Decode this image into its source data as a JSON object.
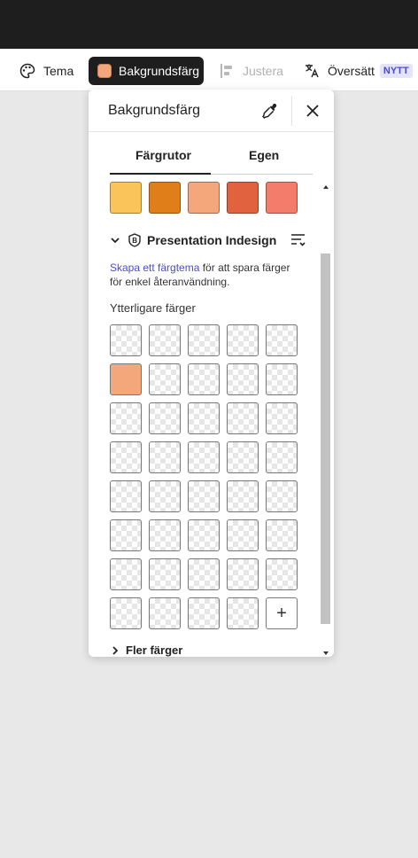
{
  "toolbar": {
    "tema_label": "Tema",
    "bakgrundsfarg_label": "Bakgrundsfärg",
    "justera_label": "Justera",
    "oversatt_label": "Översätt",
    "nytt_badge": "NYTT"
  },
  "panel": {
    "title": "Bakgrundsfärg",
    "tabs": [
      {
        "label": "Färgrutor",
        "active": true
      },
      {
        "label": "Egen",
        "active": false
      }
    ],
    "brand_colors": [
      "#fbc45b",
      "#e07f1a",
      "#f4a77a",
      "#e0623e",
      "#f47c6b"
    ],
    "kit_name": "Presentation Indesign",
    "kit_link": "Skapa ett färgtema",
    "kit_desc_rest": " för att spara färger för enkel återanvändning.",
    "more_colors_label": "Ytterligare färger",
    "more_colors": {
      "filled_index": 6,
      "filled_color": "#f4a77a",
      "empty_count": 38,
      "add_symbol": "+"
    },
    "fler_label": "Fler färger"
  },
  "icons": {
    "tema": "palette-icon",
    "justera": "align-icon",
    "oversatt": "translate-icon",
    "eyedropper": "eyedropper-icon",
    "close": "close-icon",
    "kit_brand": "brand-kit-icon",
    "kit_menu": "sort-menu-icon"
  }
}
